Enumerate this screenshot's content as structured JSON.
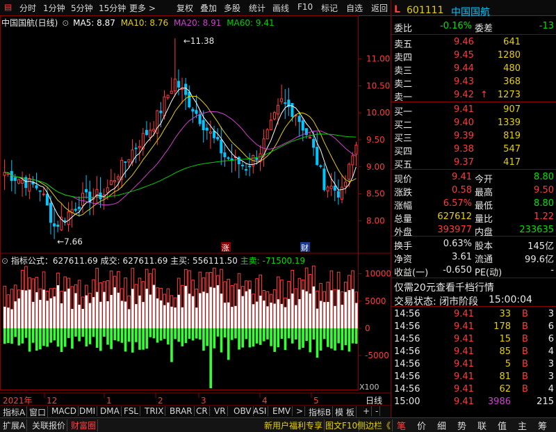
{
  "toolbar": {
    "items": [
      "分时",
      "1分钟",
      "5分钟",
      "15分钟",
      "更多 >",
      "复权",
      "叠加",
      "多股",
      "统计",
      "画线",
      "F10",
      "标记",
      "自选",
      "返回"
    ]
  },
  "chart": {
    "title": "中国国航(日线)",
    "ma5": "MA5: 8.87",
    "ma10": "MA10: 8.76",
    "ma20": "MA20: 8.91",
    "ma60": "MA60: 9.41",
    "high_label": "11.38",
    "low_label": "7.66",
    "price_ticks": [
      "11.00",
      "10.50",
      "10.00",
      "9.50",
      "9.00",
      "8.50",
      "8.00"
    ],
    "marker_zhang": "涨",
    "marker_cai": "财",
    "indicator_line": "指标公式：627611.69 成交: 627611.69 主买: 556111.50",
    "main_sell": "主卖: -71500.19",
    "vol_ticks": [
      "10000",
      "5000",
      "0",
      "-5000"
    ],
    "vol_unit": "X100",
    "year_label": "2021年",
    "months": [
      "12",
      "1",
      "2",
      "3",
      "4",
      "5"
    ],
    "period": "日线",
    "colors": {
      "up": "#ff3c3c",
      "down": "#00c8ff",
      "ma5": "#ffffff",
      "ma10": "#e6d000",
      "ma20": "#d040d0",
      "ma60": "#00d000",
      "buy_bar": "#ffffff",
      "sell_bar": "#33ff33"
    }
  },
  "quote": {
    "code": "601111",
    "name": "中国国航",
    "weibi_label": "委比",
    "weibi": "-0.16%",
    "weicha_label": "委差",
    "weicha": "-13",
    "asks": [
      {
        "label": "卖五",
        "price": "9.46",
        "vol": "641"
      },
      {
        "label": "卖四",
        "price": "9.45",
        "vol": "1280"
      },
      {
        "label": "卖三",
        "price": "9.44",
        "vol": "480"
      },
      {
        "label": "卖二",
        "price": "9.43",
        "vol": "368"
      },
      {
        "label": "卖一",
        "price": "9.42",
        "vol": "1273",
        "arrow": "↑"
      }
    ],
    "bids": [
      {
        "label": "买一",
        "price": "9.41",
        "vol": "907"
      },
      {
        "label": "买二",
        "price": "9.40",
        "vol": "1339"
      },
      {
        "label": "买三",
        "price": "9.39",
        "vol": "819"
      },
      {
        "label": "买四",
        "price": "9.38",
        "vol": "547"
      },
      {
        "label": "买五",
        "price": "9.37",
        "vol": "417"
      }
    ],
    "stats": [
      {
        "l1": "现价",
        "v1": "9.41",
        "l2": "今开",
        "v2": "8.80"
      },
      {
        "l1": "涨跌",
        "v1": "0.58",
        "l2": "最高",
        "v2": "9.50"
      },
      {
        "l1": "涨幅",
        "v1": "6.57%",
        "l2": "最低",
        "v2": "8.80"
      },
      {
        "l1": "总量",
        "v1": "627612",
        "l2": "量比",
        "v2": "1.22"
      },
      {
        "l1": "外盘",
        "v1": "393977",
        "l2": "内盘",
        "v2": "233635"
      }
    ],
    "fund": [
      {
        "l1": "换手",
        "v1": "0.63%",
        "l2": "股本",
        "v2": "145亿"
      },
      {
        "l1": "净资",
        "v1": "3.61",
        "l2": "流通",
        "v2": "99.6亿"
      },
      {
        "l1": "收益(一)",
        "v1": "-0.650",
        "l2": "PE(动)",
        "v2": "-"
      }
    ],
    "promo": "仅需20元查看千档行情",
    "trade_status": "交易状态: 闭市阶段",
    "trade_time": "15:00:04",
    "ticks": [
      {
        "t": "14:56",
        "p": "9.41",
        "v": "33",
        "d": "B",
        "n": "3"
      },
      {
        "t": "14:56",
        "p": "9.41",
        "v": "178",
        "d": "B",
        "n": "6"
      },
      {
        "t": "14:56",
        "p": "9.41",
        "v": "15",
        "d": "B",
        "n": "6"
      },
      {
        "t": "14:56",
        "p": "9.41",
        "v": "85",
        "d": "B",
        "n": "4"
      },
      {
        "t": "14:56",
        "p": "9.41",
        "v": "5",
        "d": "B",
        "n": "3"
      },
      {
        "t": "14:56",
        "p": "9.41",
        "v": "81",
        "d": "B",
        "n": "3"
      },
      {
        "t": "14:56",
        "p": "9.41",
        "v": "62",
        "d": "B",
        "n": "4"
      },
      {
        "t": "15:00",
        "p": "9.41",
        "v": "3986",
        "d": "",
        "n": "215"
      }
    ],
    "bottom_tabs": [
      "笔",
      "价",
      "细",
      "势",
      "联",
      "值",
      "主",
      "筹"
    ]
  },
  "indicator_tabs": [
    "指标A",
    "窗口",
    "MACD",
    "DMI",
    "DMA",
    "FSL",
    "TRIX",
    "BRAR",
    "CR",
    "VR",
    "OBV",
    "ASI",
    "EMV",
    "指标B",
    "模 板"
  ],
  "bottom_bar": {
    "left": [
      "扩展A",
      "关联报价",
      "财富圈"
    ],
    "right": [
      "新用户福利专享",
      "图文F10",
      "侧边栏《"
    ]
  }
}
